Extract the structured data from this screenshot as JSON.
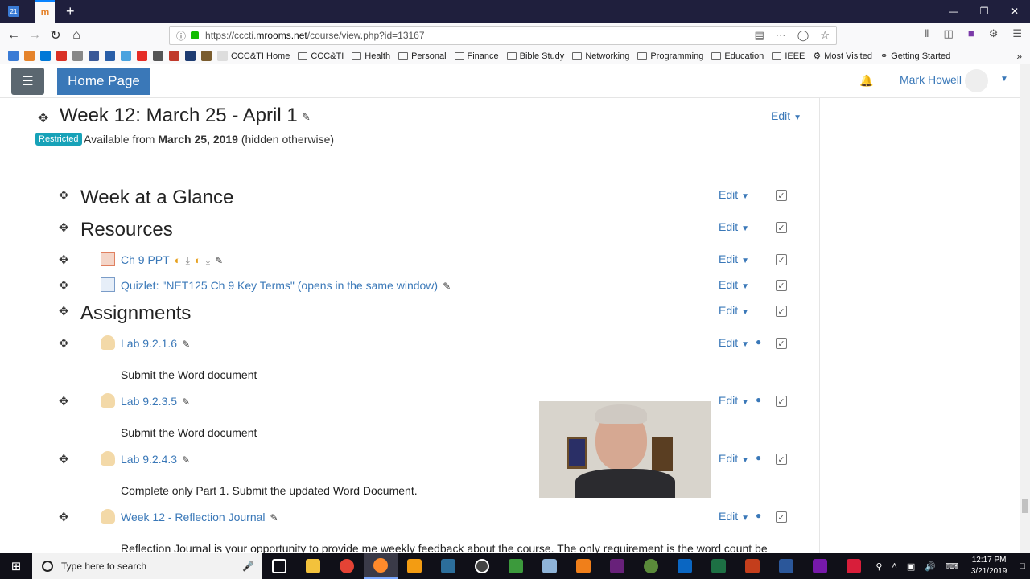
{
  "browser": {
    "url_prefix": "https://cccti.",
    "url_domain": "mrooms.net",
    "url_path": "/course/view.php?id=13167",
    "bookmarks": [
      "CCC&TI Home",
      "CCC&TI",
      "Health",
      "Personal",
      "Finance",
      "Bible Study",
      "Networking",
      "Programming",
      "Education",
      "IEEE"
    ],
    "most_visited": "Most Visited",
    "getting_started": "Getting Started"
  },
  "header": {
    "home_label": "Home Page",
    "user_name": "Mark Howell"
  },
  "week": {
    "title": "Week 12: March 25 - April 1",
    "edit_label": "Edit",
    "badge": "Restricted",
    "avail_prefix": "Available from ",
    "avail_date": "March 25, 2019",
    "avail_suffix": " (hidden otherwise)"
  },
  "edit_label": "Edit",
  "sections": {
    "glance": "Week at a Glance",
    "resources": "Resources",
    "assignments": "Assignments"
  },
  "activities": {
    "ch9ppt": "Ch 9 PPT",
    "quizlet": "Quizlet: \"NET125 Ch 9 Key Terms\" (opens in the same window)",
    "lab1": "Lab 9.2.1.6",
    "lab1_desc": "Submit the Word document",
    "lab2": "Lab 9.2.3.5",
    "lab2_desc": "Submit the Word document",
    "lab3": "Lab 9.2.4.3",
    "lab3_desc": "Complete only Part 1. Submit the updated Word Document.",
    "journal": "Week 12 - Reflection Journal",
    "journal_desc": "Reflection Journal is your opportunity to provide me weekly feedback about the course. The only requirement is the word count be"
  },
  "taskbar": {
    "search_placeholder": "Type here to search",
    "time": "12:17 PM",
    "date": "3/21/2019"
  },
  "colors": {
    "link": "#3a78b8",
    "home_button": "#3a78b8",
    "badge": "#17a2b8"
  }
}
